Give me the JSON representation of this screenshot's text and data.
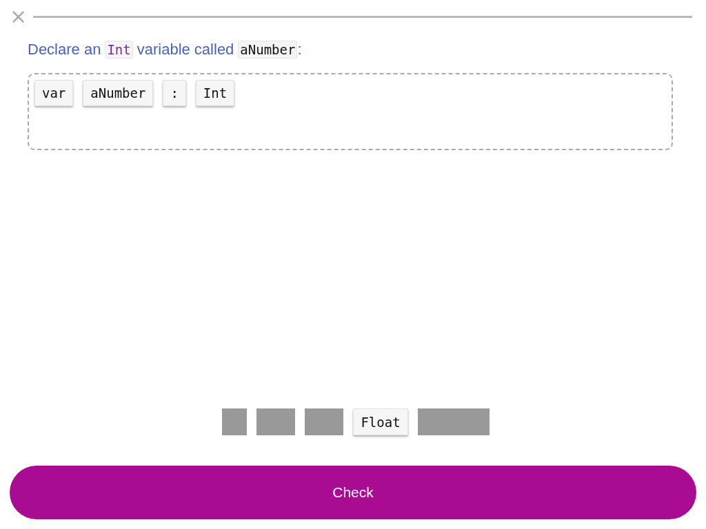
{
  "close": {
    "label": "×"
  },
  "prompt": [
    {
      "kind": "text",
      "text": "Declare an"
    },
    {
      "kind": "keyword",
      "text": "Int"
    },
    {
      "kind": "text",
      "text": "variable called"
    },
    {
      "kind": "code",
      "text": "aNumber"
    },
    {
      "kind": "text",
      "text": ":"
    }
  ],
  "answer": [
    {
      "label": "var"
    },
    {
      "label": "aNumber"
    },
    {
      "label": ":"
    },
    {
      "label": "Int"
    }
  ],
  "bank": [
    {
      "used": true
    },
    {
      "used": true
    },
    {
      "used": true
    },
    {
      "used": false,
      "label": "Float"
    },
    {
      "used": true
    }
  ],
  "check_button": {
    "label": "Check"
  }
}
